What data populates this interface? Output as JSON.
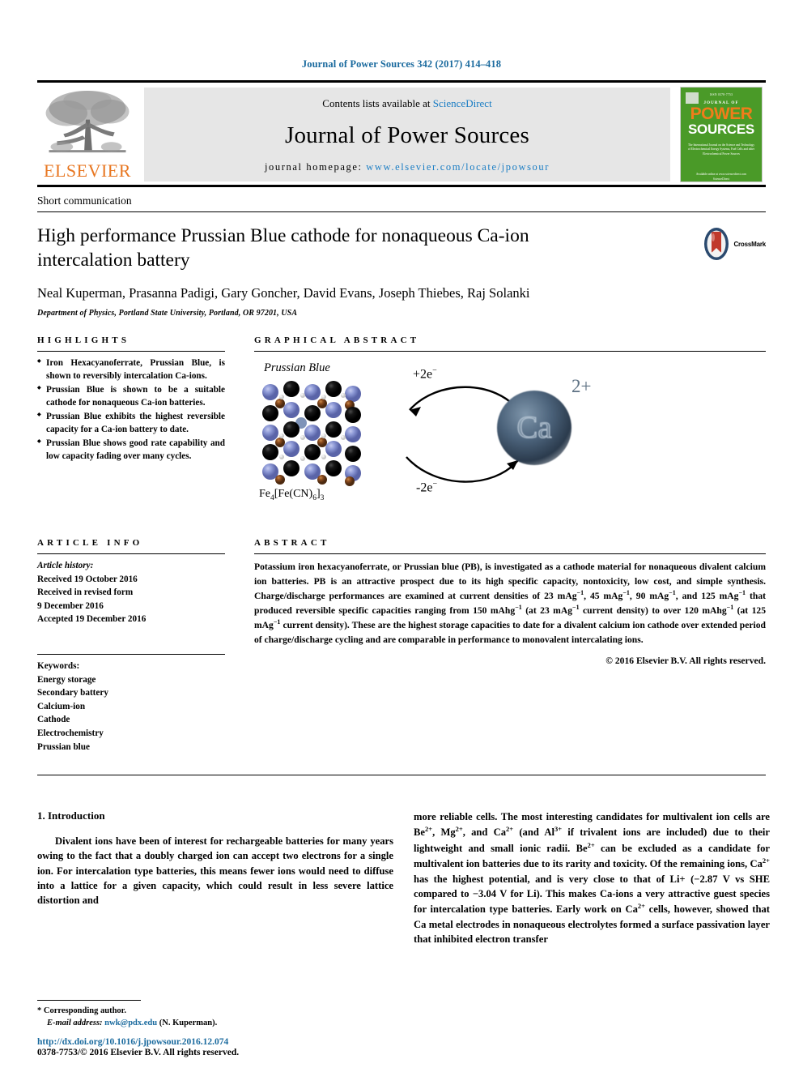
{
  "running_head": "Journal of Power Sources 342 (2017) 414–418",
  "masthead": {
    "contents_prefix": "Contents lists available at ",
    "contents_link": "ScienceDirect",
    "journal_title": "Journal of Power Sources",
    "homepage_prefix": "journal homepage: ",
    "homepage_url": "www.elsevier.com/locate/jpowsour",
    "publisher": "ELSEVIER",
    "cover": {
      "top_line": "ISSN 0378-7753",
      "journal_of": "JOURNAL OF",
      "power": "POWER",
      "sources": "SOURCES",
      "subtitle": "The International Journal on the Science and Technology of Electrochemical Energy Systems, Fuel Cells and other Electrochemical Power Sources",
      "footer": "Available online at www.sciencedirect.com ScienceDirect"
    }
  },
  "article": {
    "doctype": "Short communication",
    "title": "High performance Prussian Blue cathode for nonaqueous Ca-ion intercalation battery",
    "crossmark_label": "CrossMark",
    "authors": "Neal Kuperman, Prasanna Padigi, Gary Goncher, David Evans, Joseph Thiebes, Raj Solanki",
    "author_star": "*",
    "affiliation": "Department of Physics, Portland State University, Portland, OR 97201, USA"
  },
  "highlights": {
    "heading": "HIGHLIGHTS",
    "items": [
      "Iron Hexacyanoferrate, Prussian Blue, is shown to reversibly intercalation Ca-ions.",
      "Prussian Blue is shown to be a suitable cathode for nonaqueous Ca-ion batteries.",
      "Prussian Blue exhibits the highest reversible capacity for a Ca-ion battery to date.",
      "Prussian Blue shows good rate capability and low capacity fading over many cycles."
    ]
  },
  "article_info": {
    "heading": "ARTICLE INFO",
    "history_label": "Article history:",
    "history": [
      "Received 19 October 2016",
      "Received in revised form",
      "9 December 2016",
      "Accepted 19 December 2016"
    ],
    "keywords_label": "Keywords:",
    "keywords": [
      "Energy storage",
      "Secondary battery",
      "Calcium-ion",
      "Cathode",
      "Electrochemistry",
      "Prussian blue"
    ]
  },
  "graphical_abstract": {
    "heading": "GRAPHICAL ABSTRACT",
    "crystal_label": "Prussian Blue",
    "formula": "Fe",
    "formula_sub1": "4",
    "formula_mid": "[Fe(CN)",
    "formula_sub2": "6",
    "formula_end": "]",
    "formula_sub3": "3",
    "arrow_top_label": "+2e",
    "arrow_top_sup": "−",
    "arrow_bottom_label": "-2e",
    "arrow_bottom_sup": "−",
    "ion_label": "Ca",
    "ion_charge": "2+",
    "colors": {
      "ion_core": "#4b627a",
      "lattice_blue": "#8d99d6",
      "lattice_brown": "#8a4b1e",
      "lattice_black": "#000000"
    }
  },
  "abstract": {
    "heading": "ABSTRACT",
    "text_parts": {
      "p1": "Potassium iron hexacyanoferrate, or Prussian blue (PB), is investigated as a cathode material for nonaqueous divalent calcium ion batteries. PB is an attractive prospect due to its high specific capacity, nontoxicity, low cost, and simple synthesis. Charge/discharge performances are examined at current densities of 23 mAg",
      "p2": ", 45 mAg",
      "p3": ", 90 mAg",
      "p4": ", and 125 mAg",
      "p5": " that produced reversible specific capacities ranging from 150 mAhg",
      "p6": " (at 23 mAg",
      "p7": " current density) to over 120 mAhg",
      "p8": " (at 125 mAg",
      "p9": " current density). These are the highest storage capacities to date for a divalent calcium ion cathode over extended period of charge/discharge cycling and are comparable in performance to monovalent intercalating ions.",
      "sup": "−1"
    },
    "copyright": "© 2016 Elsevier B.V. All rights reserved."
  },
  "body": {
    "section_number_title": "1. Introduction",
    "left_paragraph": "Divalent ions have been of interest for rechargeable batteries for many years owing to the fact that a doubly charged ion can accept two electrons for a single ion. For intercalation type batteries, this means fewer ions would need to diffuse into a lattice for a given capacity, which could result in less severe lattice distortion and",
    "right_parts": {
      "r1": "more reliable cells. The most interesting candidates for multivalent ion cells are Be",
      "r2": ", Mg",
      "r3": ", and Ca",
      "r4": " (and Al",
      "r5": " if trivalent ions are included) due to their lightweight and small ionic radii. Be",
      "r6": " can be excluded as a candidate for multivalent ion batteries due to its rarity and toxicity. Of the remaining ions, Ca",
      "r7": " has the highest potential, and is very close to that of Li+ (−2.87 V vs SHE compared to −3.04 V for Li). This makes Ca-ions a very attractive guest species for intercalation type batteries. Early work on Ca",
      "r8": " cells, however, showed that Ca metal electrodes in nonaqueous electrolytes formed a surface passivation layer that inhibited electron transfer",
      "sup2": "2+",
      "sup3": "3+"
    }
  },
  "footer": {
    "corresponding_star": "*",
    "corresponding_label": "Corresponding author.",
    "email_label": "E-mail address:",
    "email": "nwk@pdx.edu",
    "email_suffix": "(N. Kuperman).",
    "doi_url": "http://dx.doi.org/10.1016/j.jpowsour.2016.12.074",
    "issn_line": "0378-7753/© 2016 Elsevier B.V. All rights reserved."
  }
}
